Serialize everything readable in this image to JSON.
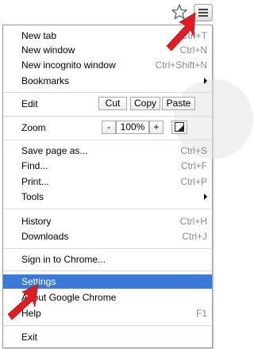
{
  "toolbar": {
    "star_icon": "star-icon",
    "menu_icon": "hamburger-icon"
  },
  "menu": {
    "new_tab": {
      "label": "New tab",
      "shortcut": "Ctrl+T"
    },
    "new_window": {
      "label": "New window",
      "shortcut": "Ctrl+N"
    },
    "new_incognito": {
      "label": "New incognito window",
      "shortcut": "Ctrl+Shift+N"
    },
    "bookmarks": {
      "label": "Bookmarks"
    },
    "edit": {
      "label": "Edit",
      "cut": "Cut",
      "copy": "Copy",
      "paste": "Paste"
    },
    "zoom": {
      "label": "Zoom",
      "minus": "-",
      "value": "100%",
      "plus": "+"
    },
    "save_page": {
      "label": "Save page as...",
      "shortcut": "Ctrl+S"
    },
    "find": {
      "label": "Find...",
      "shortcut": "Ctrl+F"
    },
    "print": {
      "label": "Print...",
      "shortcut": "Ctrl+P"
    },
    "tools": {
      "label": "Tools"
    },
    "history": {
      "label": "History",
      "shortcut": "Ctrl+H"
    },
    "downloads": {
      "label": "Downloads",
      "shortcut": "Ctrl+J"
    },
    "sign_in": {
      "label": "Sign in to Chrome..."
    },
    "settings": {
      "label": "Settings"
    },
    "about": {
      "label": "About Google Chrome"
    },
    "help": {
      "label": "Help",
      "shortcut": "F1"
    },
    "exit": {
      "label": "Exit"
    }
  },
  "colors": {
    "highlight": "#3b78d8",
    "annotation_arrow": "#e01b22",
    "shortcut_text": "#8a8a8a"
  }
}
